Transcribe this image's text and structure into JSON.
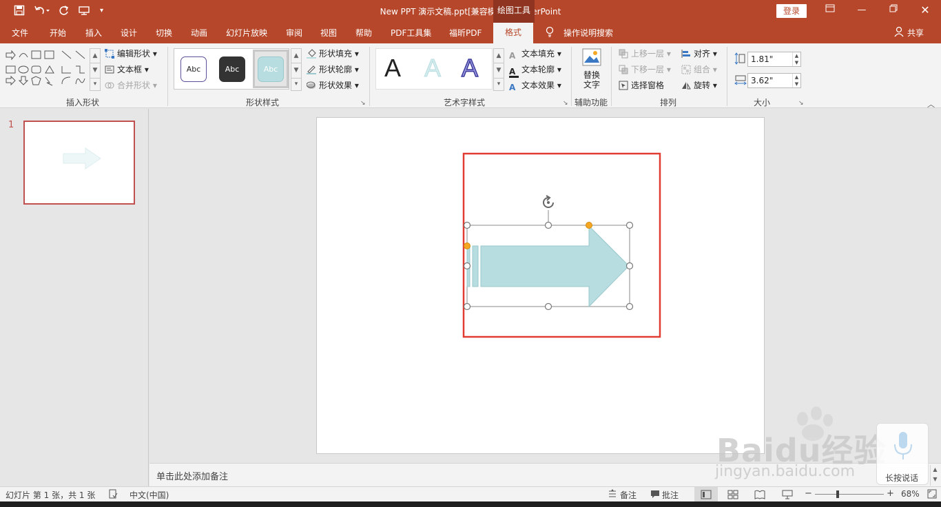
{
  "app": {
    "doc_title": "New PPT 演示文稿.ppt[兼容模式]  -  PowerPoint",
    "context_tab_group": "绘图工具",
    "login_label": "登录",
    "share_label": "共享",
    "tell_me": "操作说明搜索"
  },
  "tabs": [
    "文件",
    "开始",
    "插入",
    "设计",
    "切换",
    "动画",
    "幻灯片放映",
    "审阅",
    "视图",
    "帮助",
    "PDF工具集",
    "福昕PDF"
  ],
  "active_tab": "格式",
  "ribbon": {
    "insert_shapes": {
      "label": "插入形状",
      "edit_shape": "编辑形状",
      "text_box": "文本框",
      "merge_shapes": "合并形状"
    },
    "shape_styles": {
      "label": "形状样式",
      "samples": [
        "Abc",
        "Abc",
        "Abc"
      ],
      "fill": "形状填充",
      "outline": "形状轮廓",
      "effects": "形状效果"
    },
    "wordart_styles": {
      "label": "艺术字样式",
      "samples": [
        "A",
        "A",
        "A"
      ],
      "text_fill": "文本填充",
      "text_outline": "文本轮廓",
      "text_effects": "文本效果"
    },
    "accessibility": {
      "label": "辅助功能",
      "alt_text_1": "替换",
      "alt_text_2": "文字"
    },
    "arrange": {
      "label": "排列",
      "bring_forward": "上移一层",
      "send_backward": "下移一层",
      "selection_pane": "选择窗格",
      "align": "对齐",
      "group": "组合",
      "rotate": "旋转"
    },
    "size": {
      "label": "大小",
      "height": "1.81\"",
      "width": "3.62\""
    }
  },
  "slides_pane": {
    "slide_number": "1"
  },
  "notes_placeholder": "单击此处添加备注",
  "status": {
    "slide_info": "幻灯片 第 1 张，共 1 张",
    "language": "中文(中国)",
    "notes": "备注",
    "comments": "批注",
    "zoom": "68%"
  },
  "watermark": {
    "logo": "Baidu经验",
    "url": "jingyan.baidu.com",
    "voice_label": "长按说话"
  },
  "colors": {
    "accent": "#b7472a",
    "arrow_fill": "#b7dde0",
    "arrow_stroke": "#9bc8cc",
    "highlight_box": "#e03c31",
    "adjust_handle": "#f5a623"
  }
}
